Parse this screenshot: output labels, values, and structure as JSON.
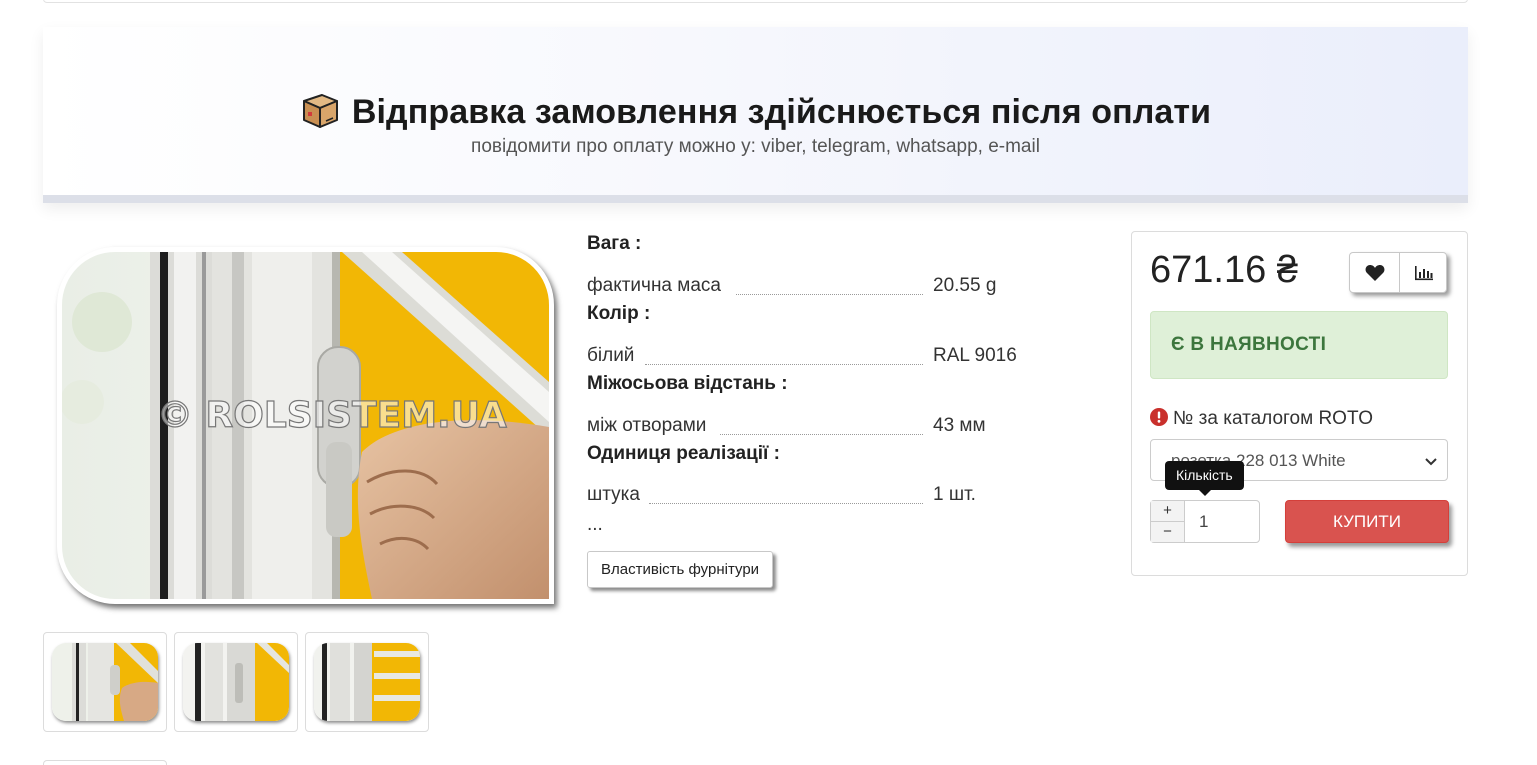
{
  "banner": {
    "title": "Відправка замовлення здійснюється після оплати",
    "subtitle": "повідомити про оплату можно у: viber, telegram, whatsapp, e-mail",
    "icon": "package-icon"
  },
  "gallery": {
    "watermark": "© ROLSISTEM.UA",
    "thumbnail_count": 3
  },
  "properties": {
    "groups": [
      {
        "title": "Вага :",
        "name": "фактична маса",
        "value": "20.55 g"
      },
      {
        "title": "Колір :",
        "name": "білий",
        "value": "RAL 9016"
      },
      {
        "title": "Міжосьова відстань :",
        "name": "між отворами",
        "value": "43 мм"
      },
      {
        "title": "Одиниця реалізації :",
        "name": "штука",
        "value": "1 шт."
      }
    ],
    "more": "...",
    "button_label": "Властивість фурнітури"
  },
  "buy": {
    "price": "671.16 ₴",
    "wishlist_icon": "heart-icon",
    "compare_icon": "bar-chart-icon",
    "stock_status": "Є В НАЯВНОСТІ",
    "catalog_label": "№ за каталогом ROTO",
    "variant_selected": "розетка 228 013 White",
    "qty_tooltip": "Кількість",
    "qty_plus": "+",
    "qty_minus": "−",
    "quantity": "1",
    "buy_label": "КУПИТИ"
  },
  "colors": {
    "stock_bg": "#dff0d8",
    "stock_text": "#3c763d",
    "buy_button": "#d9534f",
    "blind_yellow": "#f2b705"
  }
}
